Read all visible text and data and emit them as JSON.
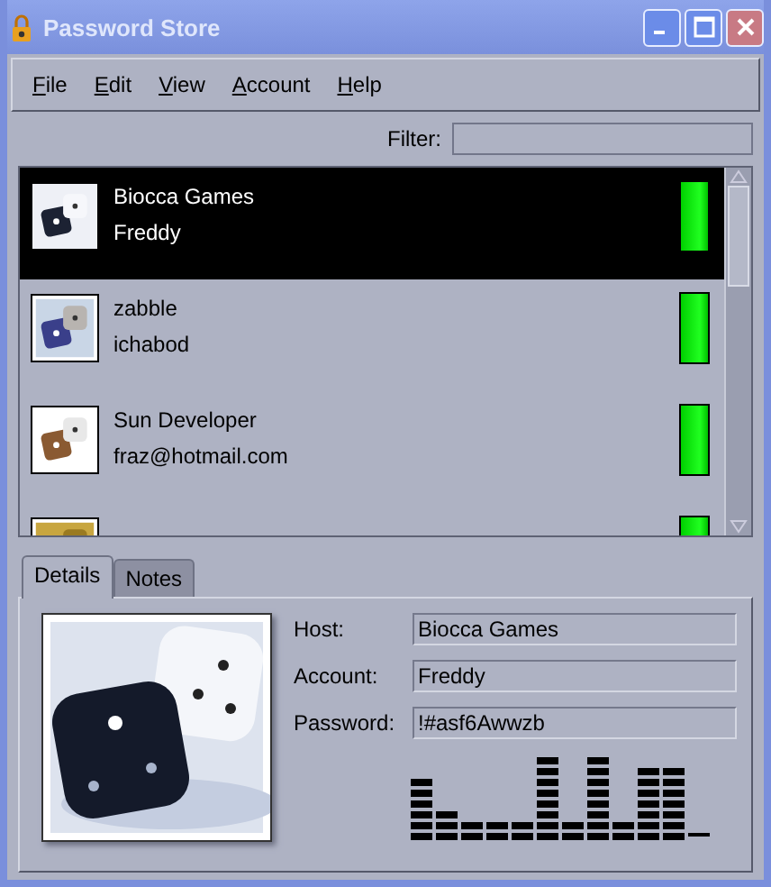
{
  "window": {
    "title": "Password Store"
  },
  "menu": [
    {
      "label": "File"
    },
    {
      "label": "Edit"
    },
    {
      "label": "View"
    },
    {
      "label": "Account"
    },
    {
      "label": "Help"
    }
  ],
  "filter": {
    "label": "Filter:"
  },
  "entries": [
    {
      "host": "Biocca Games",
      "account": "Freddy",
      "selected": true,
      "level": 1
    },
    {
      "host": "zabble",
      "account": "ichabod",
      "selected": false,
      "level": 1
    },
    {
      "host": "Sun Developer",
      "account": "fraz@hotmail.com",
      "selected": false,
      "level": 1
    },
    {
      "selected": false,
      "level": 1
    }
  ],
  "tabs": [
    {
      "label": "Details",
      "selected": true
    },
    {
      "label": "Notes",
      "selected": false
    }
  ],
  "details": {
    "fields": [
      {
        "label": "Host:",
        "value": "Biocca Games"
      },
      {
        "label": "Account:",
        "value": "Freddy"
      },
      {
        "label": "Password:",
        "value": "!#asf6Awwzb"
      }
    ]
  }
}
